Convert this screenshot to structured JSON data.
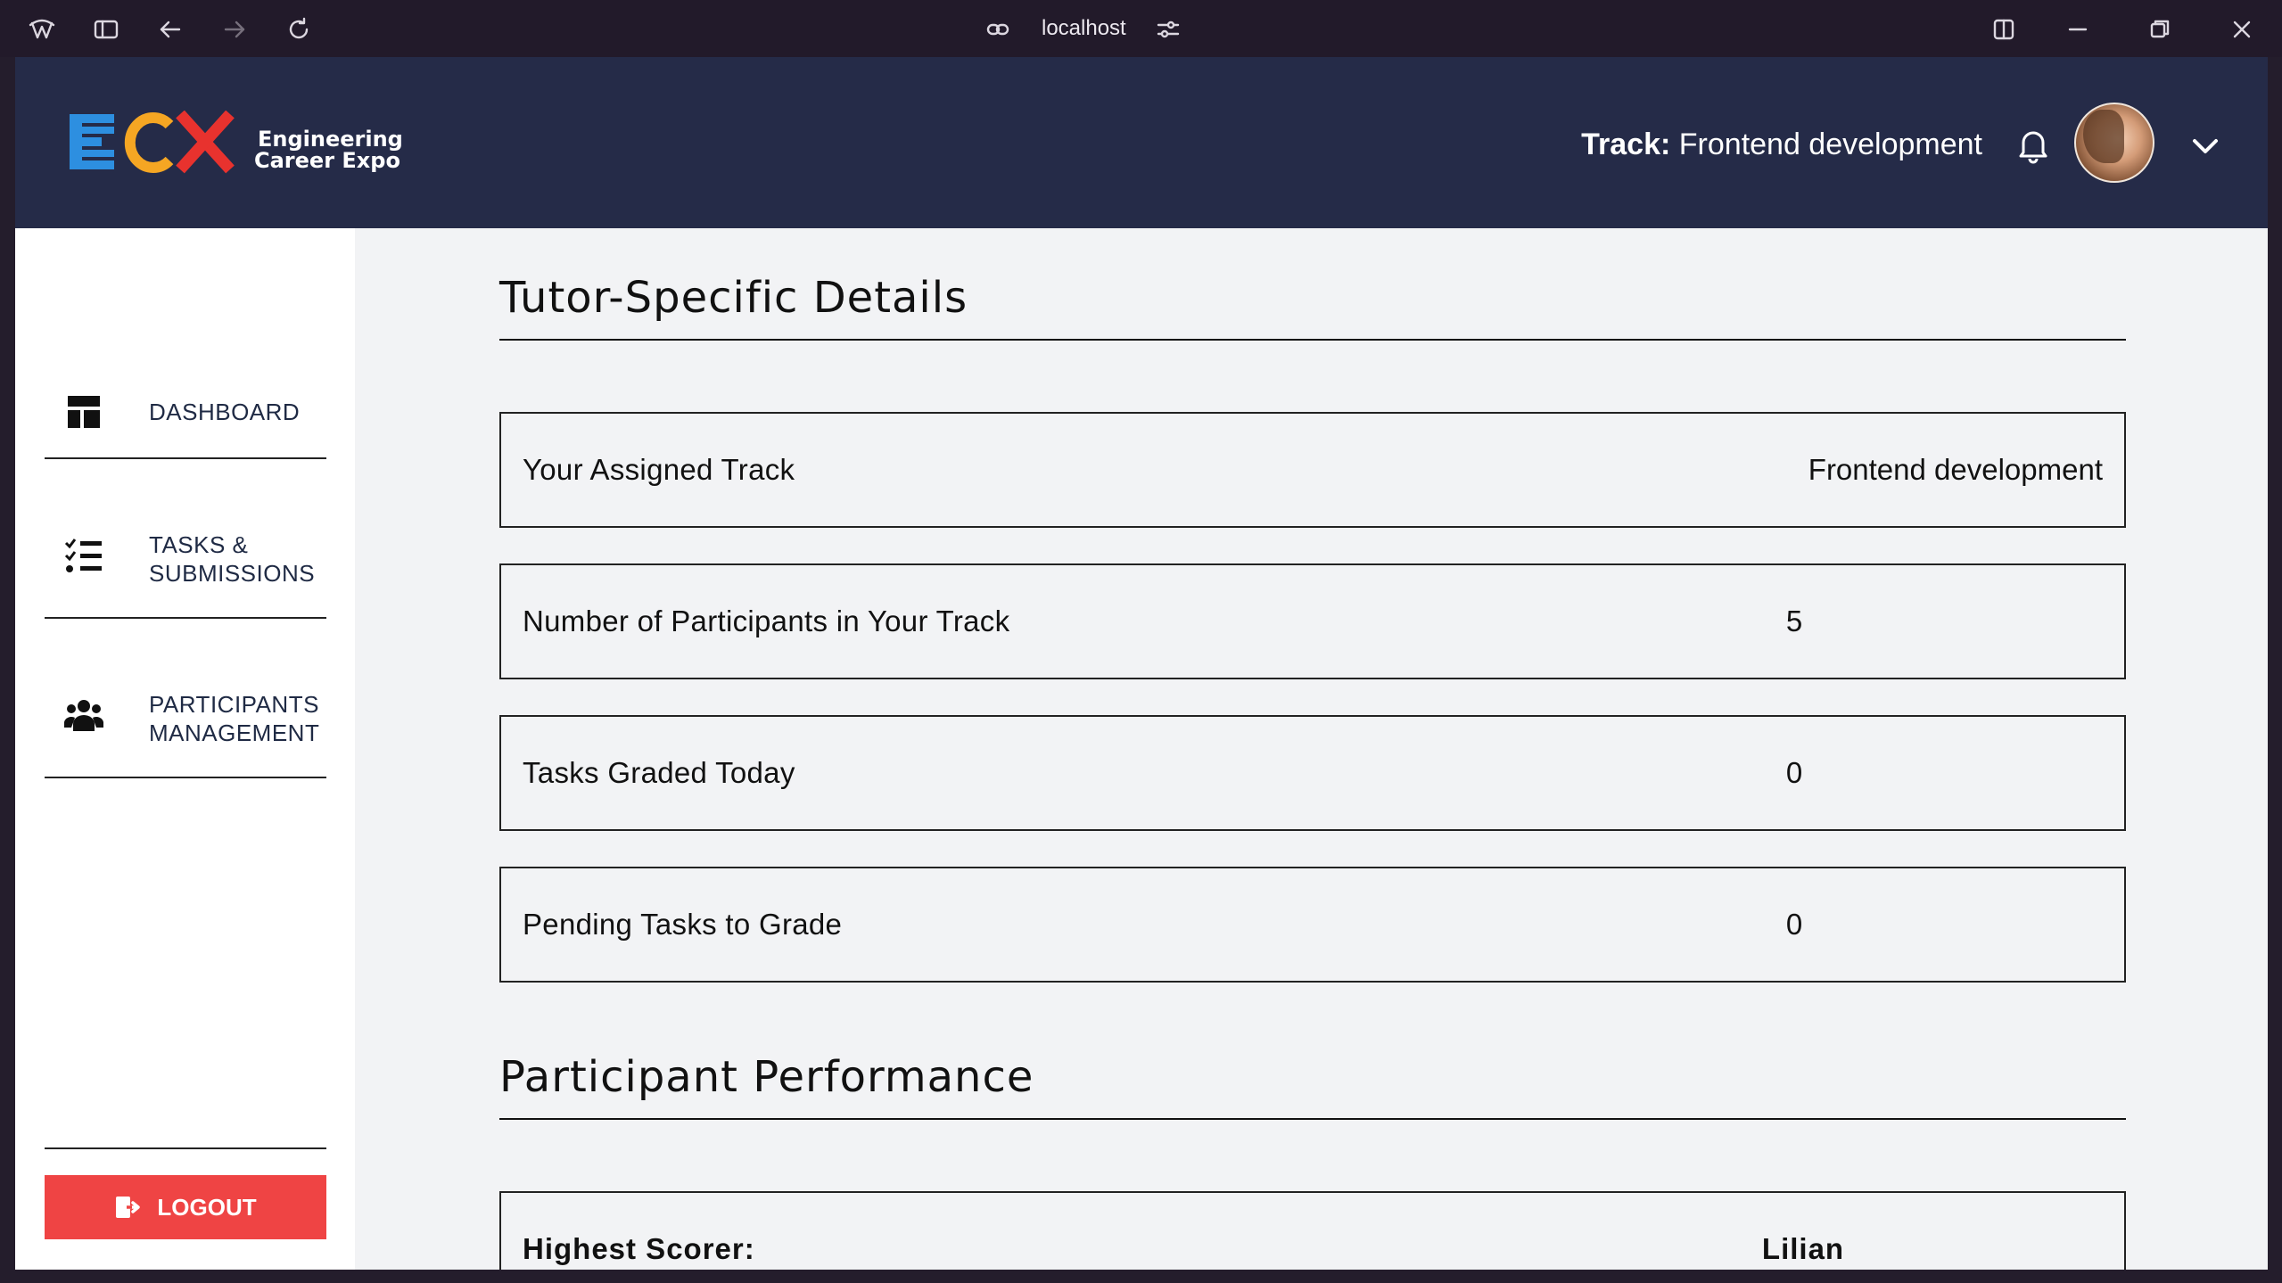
{
  "browser": {
    "url": "localhost"
  },
  "header": {
    "logo_text": "ECX",
    "logo_line1": "Engineering",
    "logo_line2": "Career Expo",
    "track_label": "Track:",
    "track_value": "Frontend development"
  },
  "sidebar": {
    "items": [
      {
        "label": "DASHBOARD",
        "icon": "dashboard-icon"
      },
      {
        "label": "TASKS & SUBMISSIONS",
        "icon": "task-list-icon"
      },
      {
        "label": "PARTICIPANTS MANAGEMENT",
        "icon": "users-icon"
      }
    ],
    "logout_label": "LOGOUT"
  },
  "main": {
    "tutor_title": "Tutor-Specific Details",
    "cards": [
      {
        "label": "Your Assigned Track",
        "value": "Frontend development"
      },
      {
        "label": "Number of Participants in Your Track",
        "value": "5"
      },
      {
        "label": "Tasks Graded Today",
        "value": "0"
      },
      {
        "label": "Pending Tasks to Grade",
        "value": "0"
      }
    ],
    "performance_title": "Participant Performance",
    "highest_scorer_label": "Highest Scorer:",
    "highest_scorer_value": "Lilian"
  },
  "colors": {
    "topbar": "#252b48",
    "logout": "#ef4444",
    "logo_blue": "#2d8fe0",
    "logo_orange": "#f5a623",
    "logo_red": "#e8322e"
  }
}
